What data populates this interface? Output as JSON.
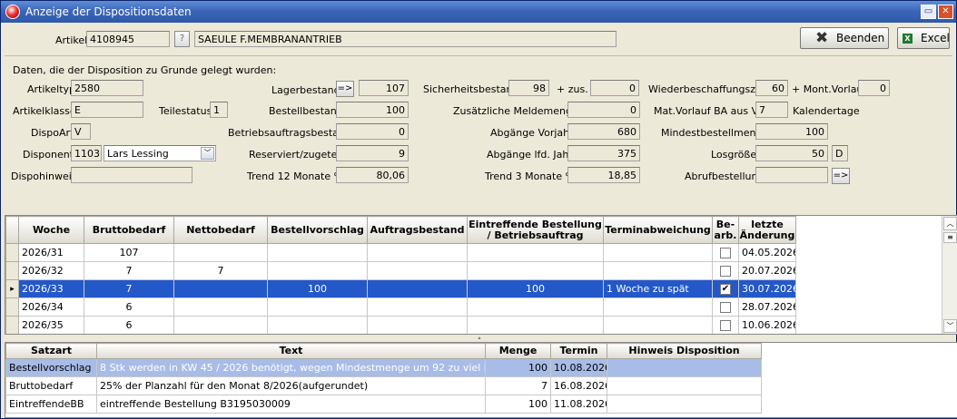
{
  "window": {
    "title": "Anzeige der Dispositionsdaten"
  },
  "header": {
    "artikel_label": "Artikel",
    "artikel_nr": "4108945",
    "help_btn": "?",
    "artikel_name": "SAEULE F.MEMBRANANTRIEB",
    "beenden_label": "Beenden",
    "excel_label": "Excel"
  },
  "info": {
    "intro": "Daten, die der Disposition zu Grunde gelegt wurden:",
    "artikeltyp_label": "Artikeltyp",
    "artikeltyp": "2580",
    "artikelklasse_label": "Artikelklasse",
    "artikelklasse": "E",
    "teilestatus_label": "Teilestatus",
    "teilestatus": "1",
    "dispoart_label": "DispoArt",
    "dispoart": "V",
    "disponent_label": "Disponent",
    "disponent_nr": "1103",
    "disponent_name": "Lars Lessing",
    "dispohinweis_label": "Dispohinweis",
    "dispohinweis": "",
    "lagerbestand_label": "Lagerbestand",
    "lagerbestand_btn": "=>",
    "lagerbestand": "107",
    "bestellbestand_label": "Bestellbestand",
    "bestellbestand": "100",
    "betriebsauftragsbestand_label": "Betriebsauftragsbestand",
    "betriebsauftragsbestand": "0",
    "reserviert_label": "Reserviert/zugeteilt",
    "reserviert": "9",
    "trend12_label": "Trend 12 Monate %",
    "trend12": "80,06",
    "sicherheitsbestand_label": "Sicherheitsbestand",
    "sicherheitsbestand": "98",
    "zus_label": "+ zus.",
    "zus": "0",
    "zus_meldemenge_label": "Zusätzliche Meldemenge",
    "zus_meldemenge": "0",
    "abgaenge_vorjahr_label": "Abgänge Vorjahr",
    "abgaenge_vorjahr": "680",
    "abgaenge_lfd_label": "Abgänge lfd. Jahr",
    "abgaenge_lfd": "375",
    "trend3_label": "Trend 3 Monate %",
    "trend3": "18,85",
    "wbz_label": "Wiederbeschaffungszeit",
    "wbz": "60",
    "montvorlauf_label": "+ Mont.Vorlauf",
    "montvorlauf": "0",
    "matvorlauf_label": "Mat.Vorlauf BA aus VA",
    "matvorlauf": "7",
    "kalendertage_label": "Kalendertage",
    "mindestbestellmenge_label": "Mindestbestellmenge",
    "mindestbestellmenge": "100",
    "losgroesse_label": "Losgröße",
    "losgroesse": "50",
    "losgroesse_unit": "D",
    "abrufbestellung_label": "Abrufbestellung",
    "abrufbestellung": "",
    "abruf_btn": "=>"
  },
  "grid1": {
    "headers": [
      "Woche",
      "Bruttobedarf",
      "Nettobedarf",
      "Bestellvorschlag",
      "Auftragsbestand",
      "Eintreffende Bestellung / Betriebsauftrag",
      "Terminabweichung",
      "Be-arb.",
      "letzte Änderung"
    ],
    "rows": [
      {
        "woche": "2026/31",
        "brutto": "107",
        "netto": "",
        "vorschlag": "",
        "auftrag": "",
        "eintreffend": "",
        "abweichung": "",
        "bearb": false,
        "aenderung": "04.05.2026"
      },
      {
        "woche": "2026/32",
        "brutto": "7",
        "netto": "7",
        "vorschlag": "",
        "auftrag": "",
        "eintreffend": "",
        "abweichung": "",
        "bearb": false,
        "aenderung": "20.07.2026"
      },
      {
        "woche": "2026/33",
        "brutto": "7",
        "netto": "",
        "vorschlag": "100",
        "auftrag": "",
        "eintreffend": "100",
        "abweichung": "1 Woche zu spät",
        "bearb": true,
        "aenderung": "30.07.2026"
      },
      {
        "woche": "2026/34",
        "brutto": "6",
        "netto": "",
        "vorschlag": "",
        "auftrag": "",
        "eintreffend": "",
        "abweichung": "",
        "bearb": false,
        "aenderung": "28.07.2026"
      },
      {
        "woche": "2026/35",
        "brutto": "6",
        "netto": "",
        "vorschlag": "",
        "auftrag": "",
        "eintreffend": "",
        "abweichung": "",
        "bearb": false,
        "aenderung": "10.06.2026"
      }
    ]
  },
  "grid2": {
    "headers": [
      "Satzart",
      "Text",
      "Menge",
      "Termin",
      "Hinweis Disposition"
    ],
    "rows": [
      {
        "satzart": "Bestellvorschlag",
        "text": "8 Stk werden in KW 45 / 2026 benötigt, wegen Mindestmenge um 92 zu viel bestellt",
        "menge": "100",
        "termin": "10.08.2026",
        "hinweis": ""
      },
      {
        "satzart": "Bruttobedarf",
        "text": "25% der Planzahl für den Monat 8/2026(aufgerundet)",
        "menge": "7",
        "termin": "16.08.2026",
        "hinweis": ""
      },
      {
        "satzart": "EintreffendeBB",
        "text": "eintreffende Bestellung B3195030009",
        "menge": "100",
        "termin": "11.08.2026",
        "hinweis": ""
      }
    ]
  },
  "colors": {
    "title_bar": "#3b66b9",
    "selection": "#2458c8",
    "selection_light": "#a8bce8",
    "background": "#ece9d8"
  }
}
